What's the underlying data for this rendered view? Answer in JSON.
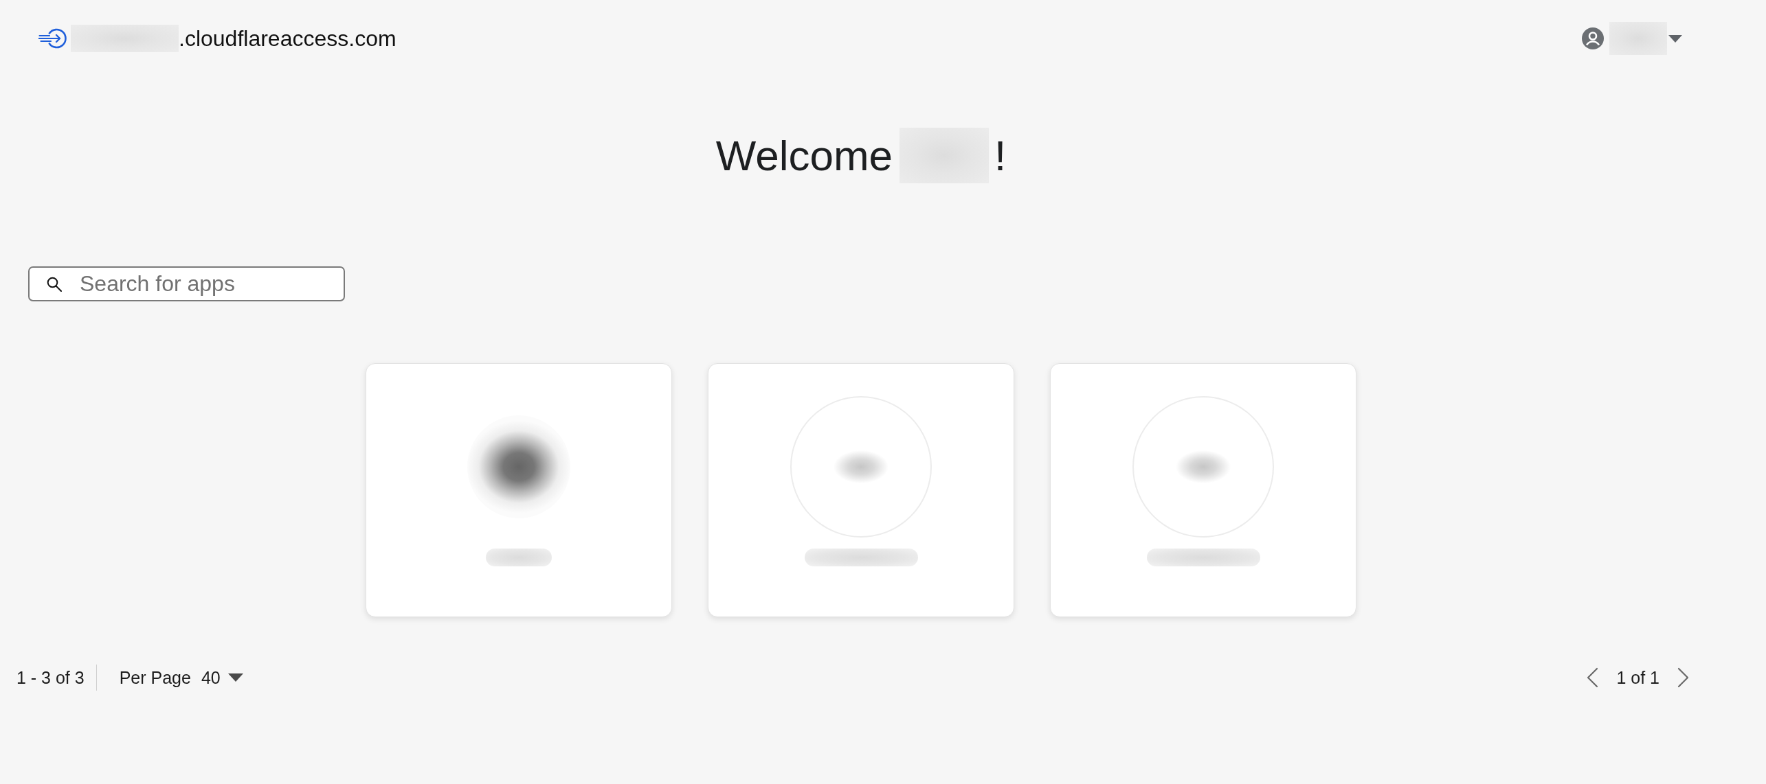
{
  "header": {
    "domain_suffix": ".cloudflareaccess.com"
  },
  "welcome": {
    "greeting": "Welcome",
    "closing": "!"
  },
  "search": {
    "placeholder": "Search for apps"
  },
  "apps": [
    {
      "kind": "dark-logo"
    },
    {
      "kind": "light-logo"
    },
    {
      "kind": "light-logo"
    }
  ],
  "pagination": {
    "range": "1 - 3 of 3",
    "per_page_label": "Per Page",
    "per_page": "40",
    "page": "1 of 1"
  }
}
